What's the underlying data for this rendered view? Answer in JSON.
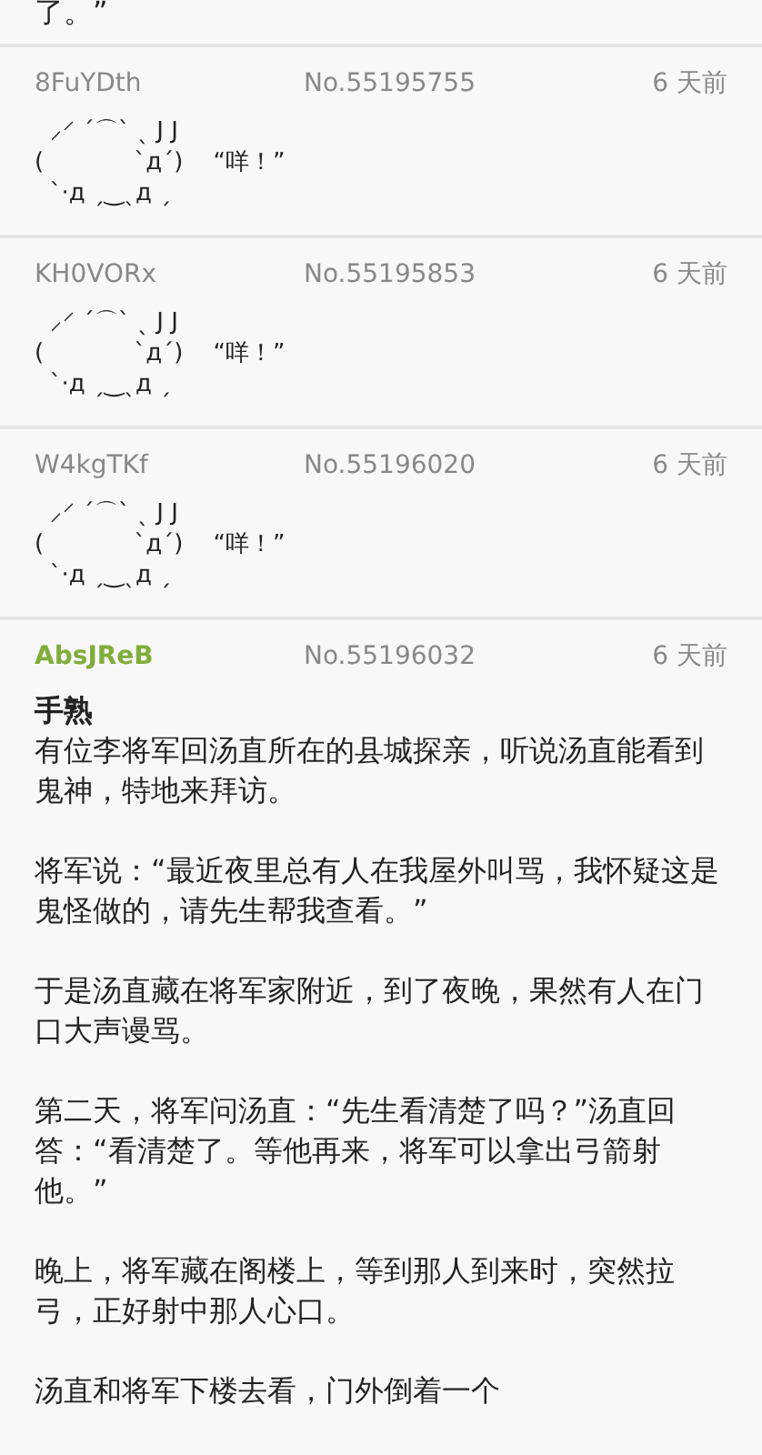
{
  "cut_text": "了。”",
  "posts": [
    {
      "author": "8FuYDth",
      "is_op": false,
      "number": "No.55195755",
      "time": "6 天前",
      "art": [
        "  ⸝⸍ ˊ⌒ˋ ˎ J J",
        "(            `д´)    “咩！”",
        "  ˋ·д ˏ‿ˎд ˏ"
      ]
    },
    {
      "author": "KH0VORx",
      "is_op": false,
      "number": "No.55195853",
      "time": "6 天前",
      "art": [
        "  ⸝⸍ ˊ⌒ˋ ˎ J J",
        "(            `д´)    “咩！”",
        "  ˋ·д ˏ‿ˎд ˏ"
      ]
    },
    {
      "author": "W4kgTKf",
      "is_op": false,
      "number": "No.55196020",
      "time": "6 天前",
      "art": [
        "  ⸝⸍ ˊ⌒ˋ ˎ J J",
        "(            `д´)    “咩！”",
        "  ˋ·д ˏ‿ˎд ˏ"
      ]
    },
    {
      "author": "AbsJReB",
      "is_op": true,
      "number": "No.55196032",
      "time": "6 天前",
      "title": "手熟",
      "paragraphs": [
        "有位李将军回汤直所在的县城探亲，听说汤直能看到鬼神，特地来拜访。",
        "将军说：“最近夜里总有人在我屋外叫骂，我怀疑这是鬼怪做的，请先生帮我查看。”",
        "于是汤直藏在将军家附近，到了夜晚，果然有人在门口大声谩骂。",
        "第二天，将军问汤直：“先生看清楚了吗？”汤直回答：“看清楚了。等他再来，将军可以拿出弓箭射他。”",
        "晚上，将军藏在阁楼上，等到那人到来时，突然拉弓，正好射中那人心口。",
        "汤直和将军下楼去看，门外倒着一个"
      ]
    }
  ]
}
